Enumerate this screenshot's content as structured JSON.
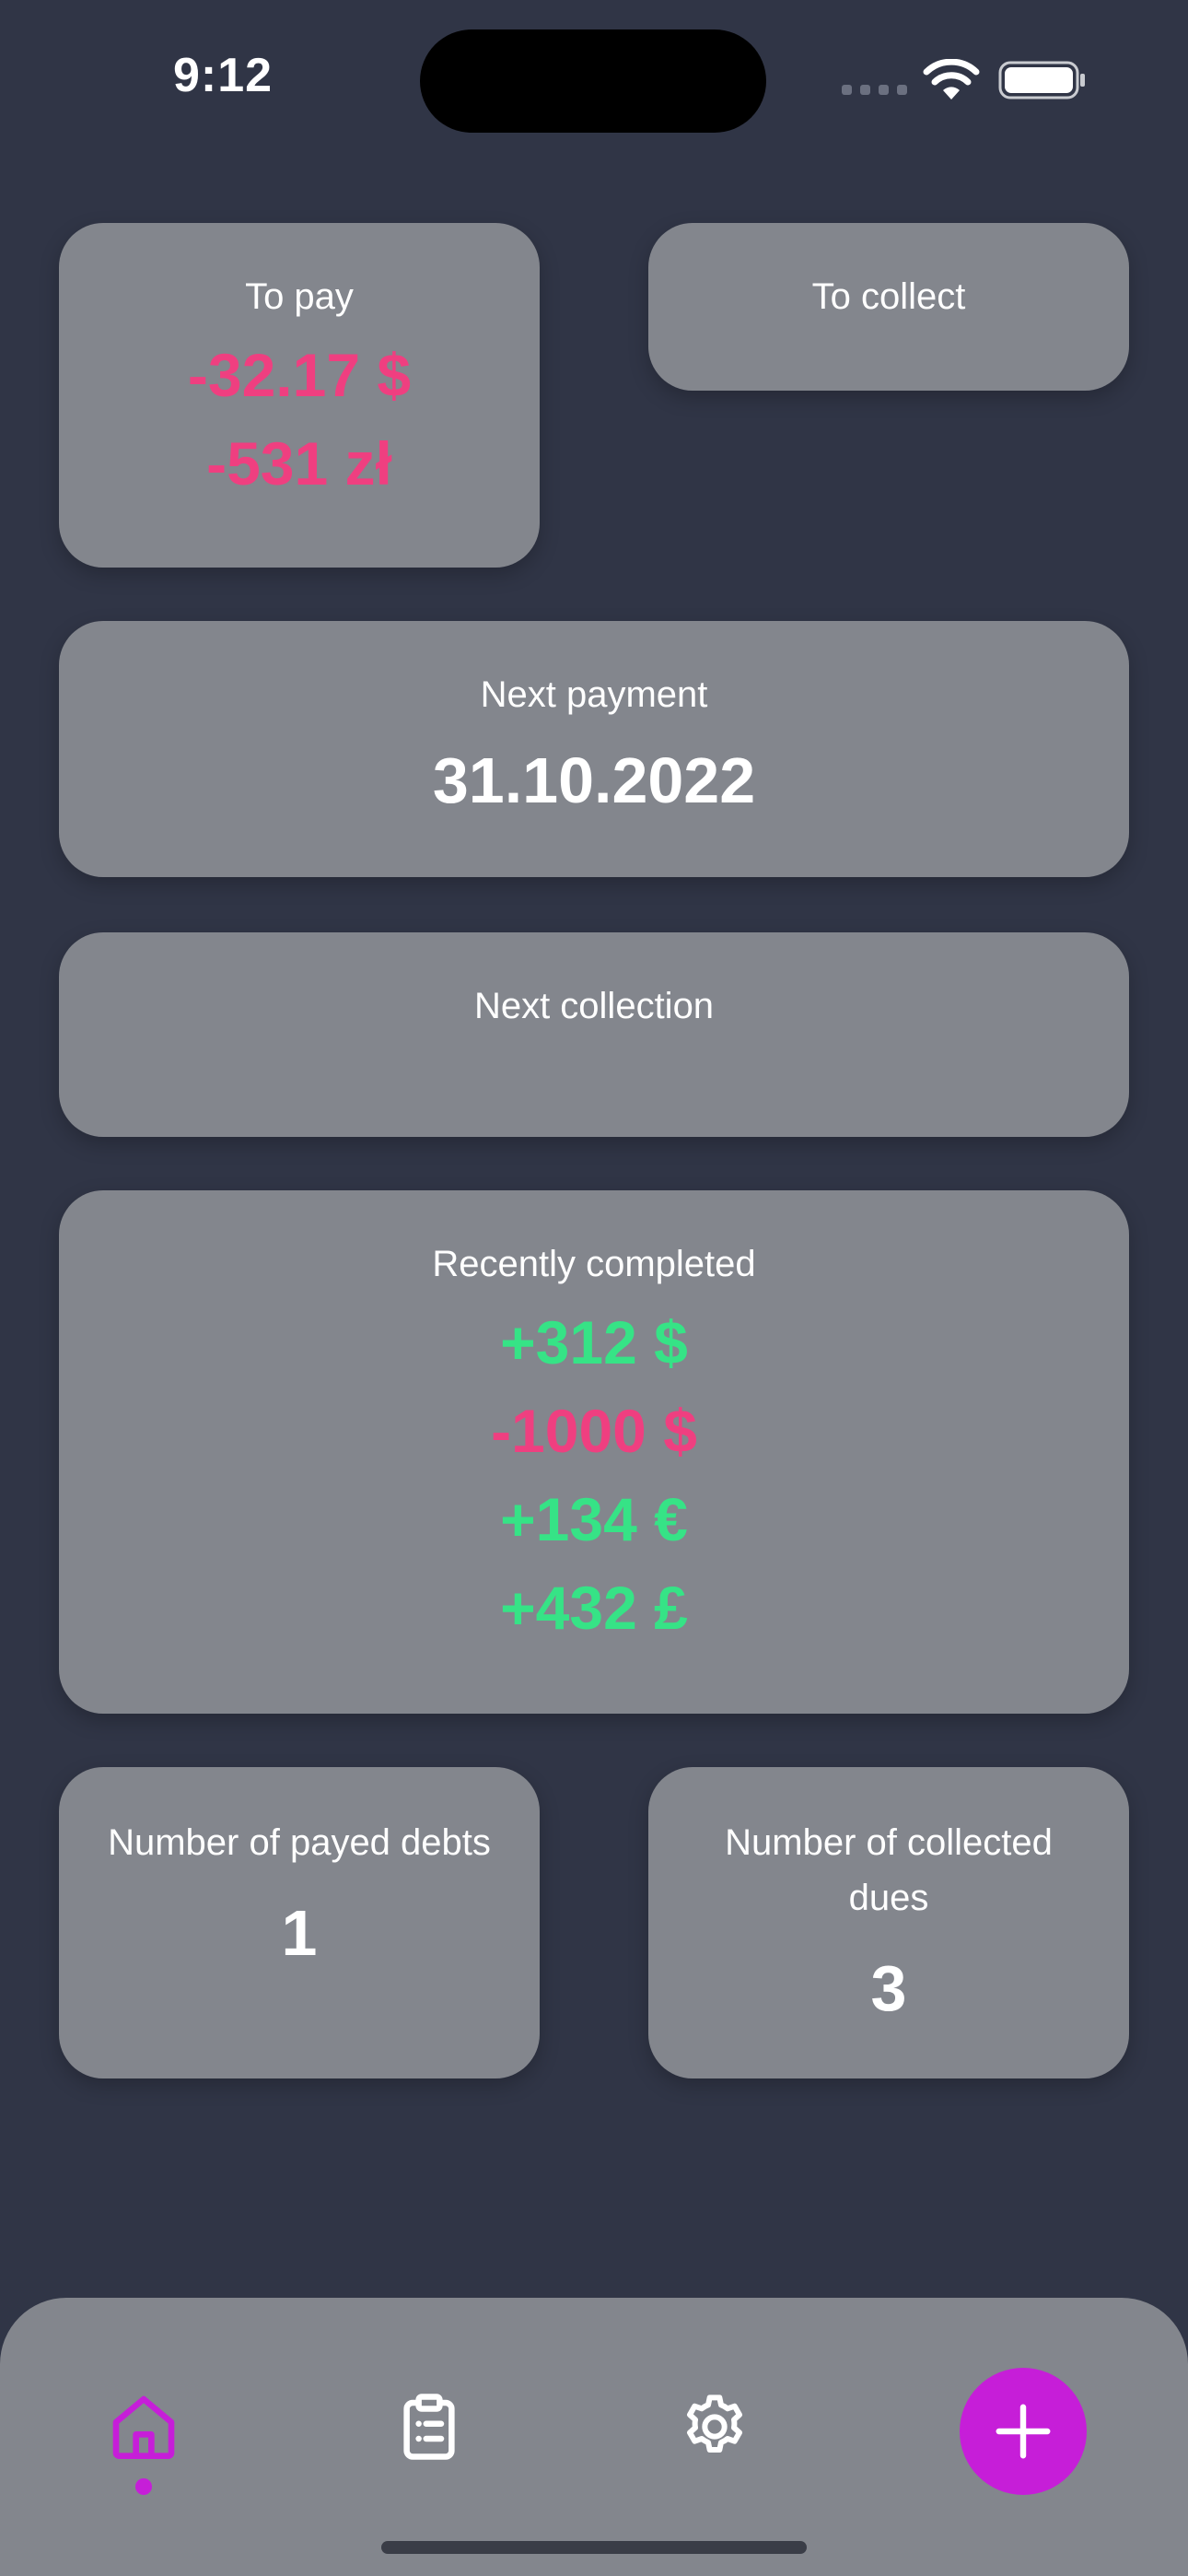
{
  "status_bar": {
    "time": "9:12"
  },
  "to_pay": {
    "label": "To pay",
    "amounts": [
      "-32.17 $",
      "-531 zł"
    ]
  },
  "to_collect": {
    "label": "To collect"
  },
  "next_payment": {
    "label": "Next payment",
    "date": "31.10.2022"
  },
  "next_collection": {
    "label": "Next collection"
  },
  "recently_completed": {
    "label": "Recently completed",
    "amounts": [
      "+312 $",
      "-1000 $",
      "+134 €",
      "+432 £"
    ]
  },
  "payed_debts": {
    "label": "Number of payed debts",
    "value": "1"
  },
  "collected_dues": {
    "label": "Number of collected dues",
    "value": "3"
  },
  "tab_bar": {
    "tabs": [
      "home-icon",
      "clipboard-list-icon",
      "gear-icon"
    ],
    "active": "home",
    "action": "plus-icon"
  },
  "colors": {
    "background": "#303546",
    "card": "#83868d",
    "negative": "#ef3f80",
    "positive": "#36e386",
    "accent": "#c61ed8"
  }
}
